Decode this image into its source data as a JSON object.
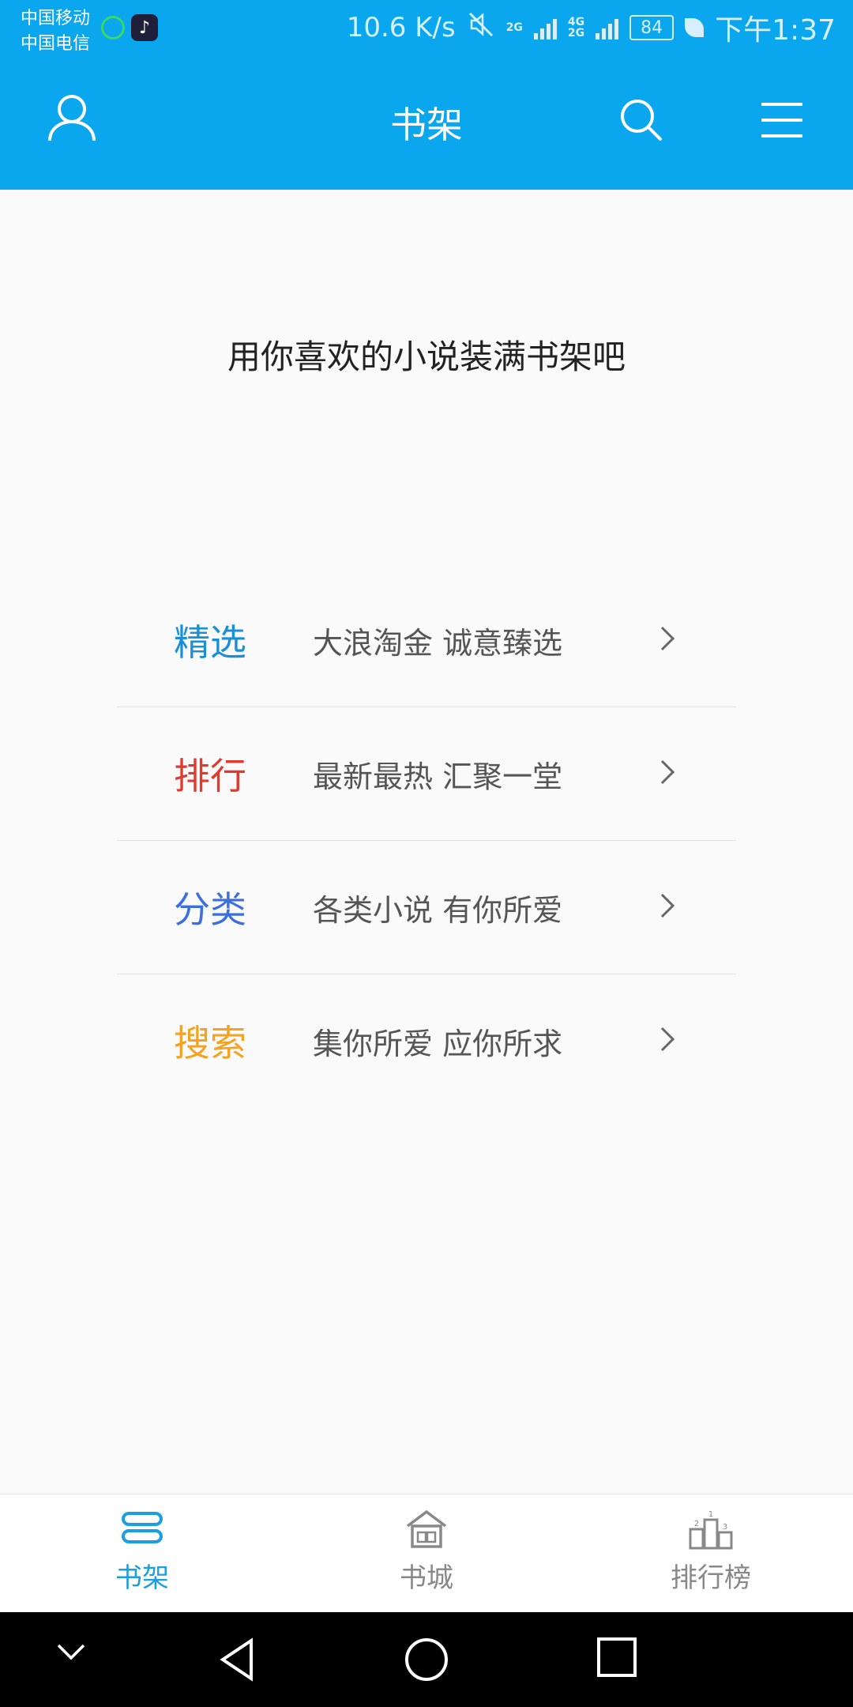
{
  "status_bar": {
    "carrier_1": "中国移动",
    "carrier_2": "中国电信",
    "net_speed": "10.6 K/s",
    "net_2g": "2G",
    "net_4g": "4G",
    "net_2g_b": "2G",
    "battery": "84",
    "time": "下午1:37"
  },
  "header": {
    "title": "书架",
    "bg_color": "#0aa6ee",
    "icons": [
      "user-icon",
      "search-icon",
      "menu-icon"
    ]
  },
  "main": {
    "empty_message": "用你喜欢的小说装满书架吧",
    "features": [
      {
        "title": "精选",
        "desc": "大浪淘金  诚意臻选",
        "color": "#1a8fd6"
      },
      {
        "title": "排行",
        "desc": "最新最热  汇聚一堂",
        "color": "#e03a2f"
      },
      {
        "title": "分类",
        "desc": "各类小说  有你所爱",
        "color": "#3b6fe0"
      },
      {
        "title": "搜索",
        "desc": "集你所爱  应你所求",
        "color": "#f4a21f"
      }
    ]
  },
  "tabbar": {
    "tabs": [
      {
        "label": "书架",
        "icon": "bookshelf-icon",
        "active": true
      },
      {
        "label": "书城",
        "icon": "bookstore-icon",
        "active": false
      },
      {
        "label": "排行榜",
        "icon": "ranking-icon",
        "active": false
      }
    ],
    "active_color": "#1a9fe2"
  }
}
